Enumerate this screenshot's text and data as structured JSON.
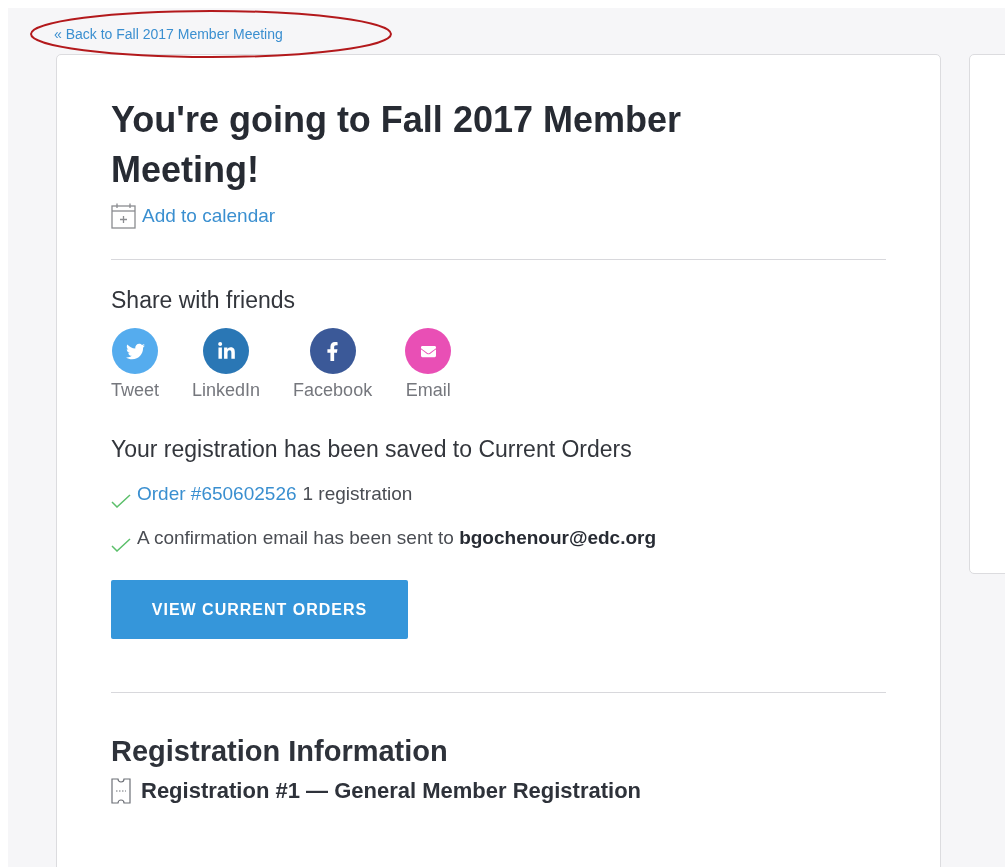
{
  "back_link": "« Back to Fall 2017 Member Meeting",
  "title": "You're going to Fall 2017 Member Meeting!",
  "add_to_calendar": "Add to calendar",
  "share": {
    "heading": "Share with friends",
    "items": [
      {
        "kind": "twitter",
        "label": "Tweet",
        "color": "#55acee"
      },
      {
        "kind": "linkedin",
        "label": "LinkedIn",
        "color": "#2a77b5"
      },
      {
        "kind": "facebook",
        "label": "Facebook",
        "color": "#3b5998"
      },
      {
        "kind": "email",
        "label": "Email",
        "color": "#e94fb5"
      }
    ]
  },
  "saved": {
    "heading": "Your registration has been saved to Current Orders",
    "items": [
      {
        "kind": "link",
        "link": "Order #650602526",
        "text": "1 registration"
      },
      {
        "kind": "text",
        "text": "A confirmation email has been sent to **bgochenour@edc.org**"
      }
    ]
  },
  "button": "VIEW CURRENT ORDERS",
  "registration": {
    "heading": "Registration Information",
    "item": "Registration #1 — General Member Registration"
  }
}
